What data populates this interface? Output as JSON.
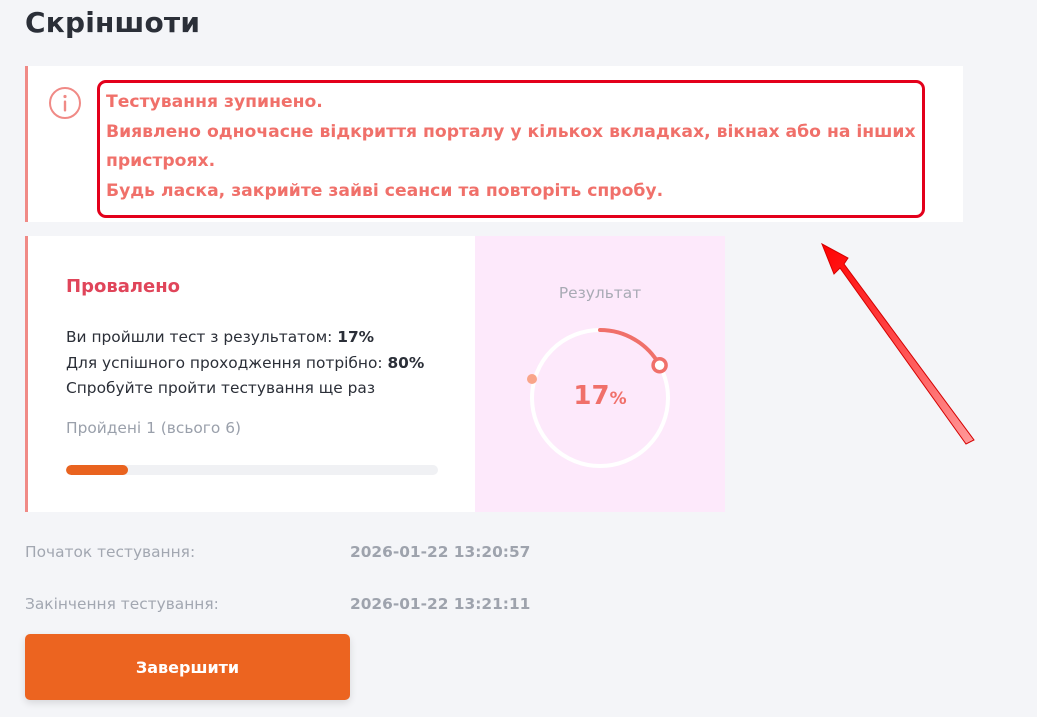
{
  "page": {
    "title": "Скріншоти"
  },
  "alert": {
    "icon": "info-icon",
    "lines": [
      "Тестування зупинено.",
      "Виявлено одночасне відкриття порталу у кількох вкладках, вікнах або на інших",
      "пристроях.",
      "Будь ласка, закрийте зайві сеанси та повторіть спробу."
    ],
    "text_color": "#f0706a",
    "highlight_color": "#e3001b"
  },
  "result": {
    "status": "Провалено",
    "line1_prefix": "Ви пройшли тест з результатом: ",
    "line1_value": "17%",
    "line2_prefix": "Для успішного проходження потрібно: ",
    "line2_value": "80%",
    "line3": "Спробуйте пройти тестування ще раз",
    "passed_text": "Пройдені 1 (всього 6)",
    "progress_fraction": 0.1667,
    "status_color": "#e0455a",
    "progress_color": "#e9631f"
  },
  "score": {
    "label": "Результат",
    "value": "17",
    "unit": "%",
    "fraction": 0.17,
    "accent_color": "#f0706a"
  },
  "meta": {
    "start_label": "Початок тестування:",
    "start_value": "2026-01-22 13:20:57",
    "end_label": "Закінчення тестування:",
    "end_value": "2026-01-22 13:21:11"
  },
  "actions": {
    "finish_label": "Завершити",
    "finish_color": "#ec6420"
  }
}
